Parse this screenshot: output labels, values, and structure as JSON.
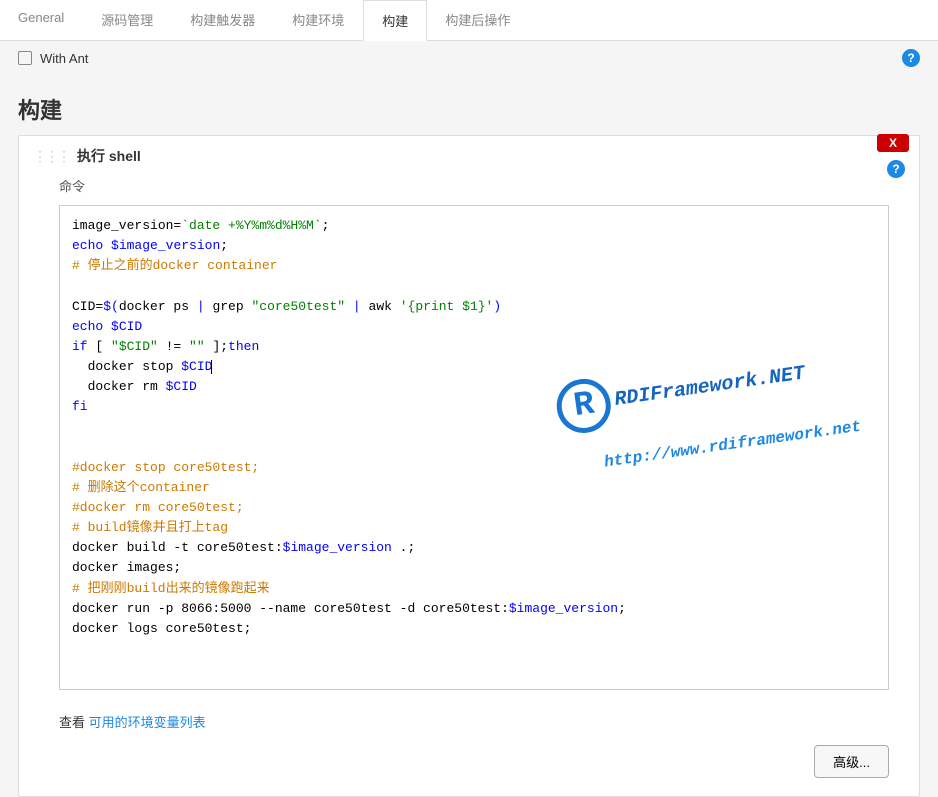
{
  "tabs": [
    "General",
    "源码管理",
    "构建触发器",
    "构建环境",
    "构建",
    "构建后操作"
  ],
  "active_tab_index": 4,
  "with_ant_label": "With Ant",
  "section_title": "构建",
  "panel": {
    "close_label": "X",
    "title": "执行 shell",
    "command_label": "命令",
    "footer_prefix": "查看 ",
    "footer_link": "可用的环境变量列表",
    "advanced_btn": "高级..."
  },
  "code": {
    "l1a": "image_version=",
    "l1b": "`date +%Y%m%d%H%M`",
    "l1c": ";",
    "l2a": "echo",
    "l2b": " ",
    "l2c": "$image_version",
    "l2d": ";",
    "l3": "# 停止之前的docker container",
    "l5a": "CID=",
    "l5b": "$(",
    "l5c": "docker ps ",
    "l5d": "|",
    "l5e": " grep ",
    "l5f": "\"core50test\"",
    "l5g": " ",
    "l5h": "|",
    "l5i": " awk ",
    "l5j": "'{print $1}'",
    "l5k": ")",
    "l6a": "echo",
    "l6b": " ",
    "l6c": "$CID",
    "l7a": "if",
    "l7b": " [ ",
    "l7c": "\"$CID\"",
    "l7d": " != ",
    "l7e": "\"\"",
    "l7f": " ];",
    "l7g": "then",
    "l8a": "  docker stop ",
    "l8b": "$CID",
    "l9a": "  docker rm ",
    "l9b": "$CID",
    "l10": "fi",
    "l13": "#docker stop core50test;",
    "l14": "# 删除这个container",
    "l15": "#docker rm core50test;",
    "l16": "# build镜像并且打上tag",
    "l17a": "docker build -t core50test:",
    "l17b": "$image_version",
    "l17c": " .;",
    "l18": "docker images;",
    "l19": "# 把刚刚build出来的镜像跑起来",
    "l20a": "docker run -p 8066:5000 --name core50test -d core50test:",
    "l20b": "$image_version",
    "l20c": ";",
    "l21": "docker logs core50test;"
  },
  "watermark": {
    "logo": "R",
    "text1": "RDIFramework.NET",
    "text2": "http://www.rdiframework.net"
  }
}
